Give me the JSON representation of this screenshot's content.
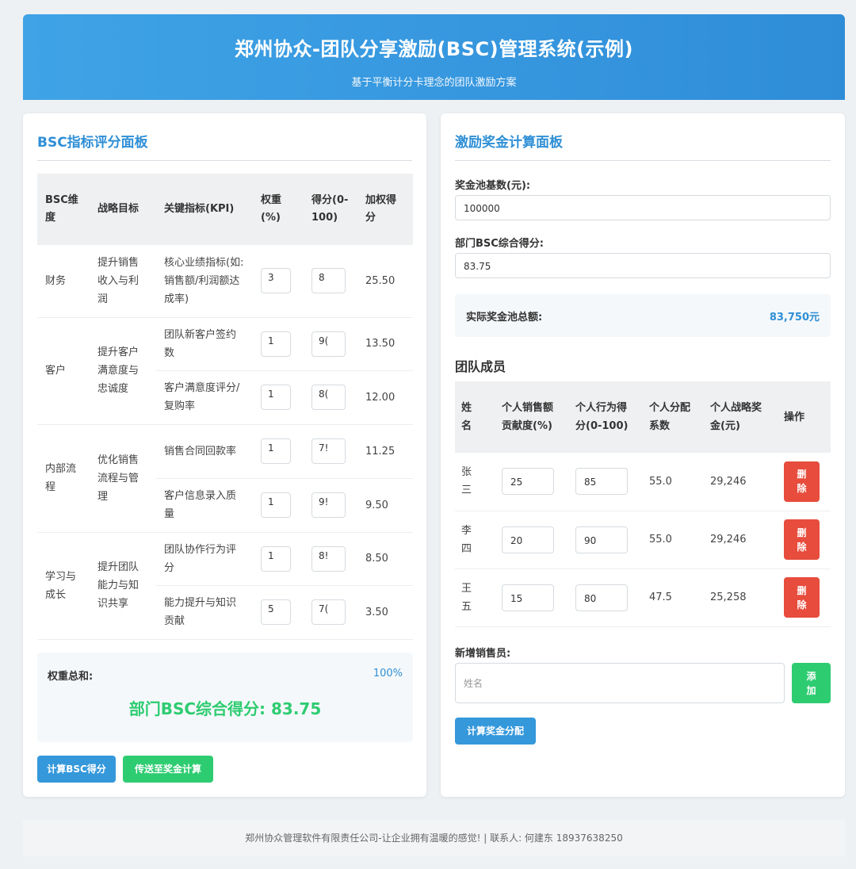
{
  "header": {
    "title": "郑州协众-团队分享激励(BSC)管理系统(示例)",
    "subtitle": "基于平衡计分卡理念的团队激励方案"
  },
  "bsc_panel": {
    "title": "BSC指标评分面板",
    "columns": [
      "BSC维度",
      "战略目标",
      "关键指标(KPI)",
      "权重(%)",
      "得分(0-100)",
      "加权得分"
    ],
    "groups": [
      {
        "dimension": "财务",
        "goal": "提升销售收入与利润",
        "kpis": [
          {
            "name": "核心业绩指标(如:销售额/利润额达成率)",
            "weight": "3",
            "score": "8",
            "weighted": "25.50"
          }
        ]
      },
      {
        "dimension": "客户",
        "goal": "提升客户满意度与忠诚度",
        "kpis": [
          {
            "name": "团队新客户签约数",
            "weight": "1",
            "score": "9(",
            "weighted": "13.50"
          },
          {
            "name": "客户满意度评分/复购率",
            "weight": "1",
            "score": "8(",
            "weighted": "12.00"
          }
        ]
      },
      {
        "dimension": "内部流程",
        "goal": "优化销售流程与管理",
        "kpis": [
          {
            "name": "销售合同回款率",
            "weight": "1",
            "score": "7!",
            "weighted": "11.25"
          },
          {
            "name": "客户信息录入质量",
            "weight": "1",
            "score": "9!",
            "weighted": "9.50"
          }
        ]
      },
      {
        "dimension": "学习与成长",
        "goal": "提升团队能力与知识共享",
        "kpis": [
          {
            "name": "团队协作行为评分",
            "weight": "1",
            "score": "8!",
            "weighted": "8.50"
          },
          {
            "name": "能力提升与知识贡献",
            "weight": "5",
            "score": "7(",
            "weighted": "3.50"
          }
        ]
      }
    ],
    "weight_sum_label": "权重总和:",
    "weight_sum_value": "100%",
    "score_text": "部门BSC综合得分: 83.75",
    "calc_button": "计算BSC得分",
    "send_button": "传送至奖金计算"
  },
  "bonus_panel": {
    "title": "激励奖金计算面板",
    "pool_base_label": "奖金池基数(元):",
    "pool_base_value": "100000",
    "dept_score_label": "部门BSC综合得分:",
    "dept_score_value": "83.75",
    "actual_pool_label": "实际奖金池总额:",
    "actual_pool_value": "83,750元",
    "team_title": "团队成员",
    "team_columns": [
      "姓名",
      "个人销售额贡献度(%)",
      "个人行为得分(0-100)",
      "个人分配系数",
      "个人战略奖金(元)",
      "操作"
    ],
    "members": [
      {
        "name": "张三",
        "contribution": "25",
        "behavior": "85",
        "coef": "55.0",
        "bonus": "29,246",
        "action": "删除"
      },
      {
        "name": "李四",
        "contribution": "20",
        "behavior": "90",
        "coef": "55.0",
        "bonus": "29,246",
        "action": "删除"
      },
      {
        "name": "王五",
        "contribution": "15",
        "behavior": "80",
        "coef": "47.5",
        "bonus": "25,258",
        "action": "删除"
      }
    ],
    "new_member_label": "新增销售员:",
    "new_member_placeholder": "姓名",
    "add_button": "添加",
    "calc_button": "计算奖金分配"
  },
  "footer": {
    "text": "郑州协众管理软件有限责任公司-让企业拥有温暖的感觉! | 联系人: 何建东 18937638250"
  },
  "colors": {
    "header": "#3498db",
    "accent": "#2f8fd6",
    "green": "#2ecc71",
    "red": "#e74c3c"
  }
}
